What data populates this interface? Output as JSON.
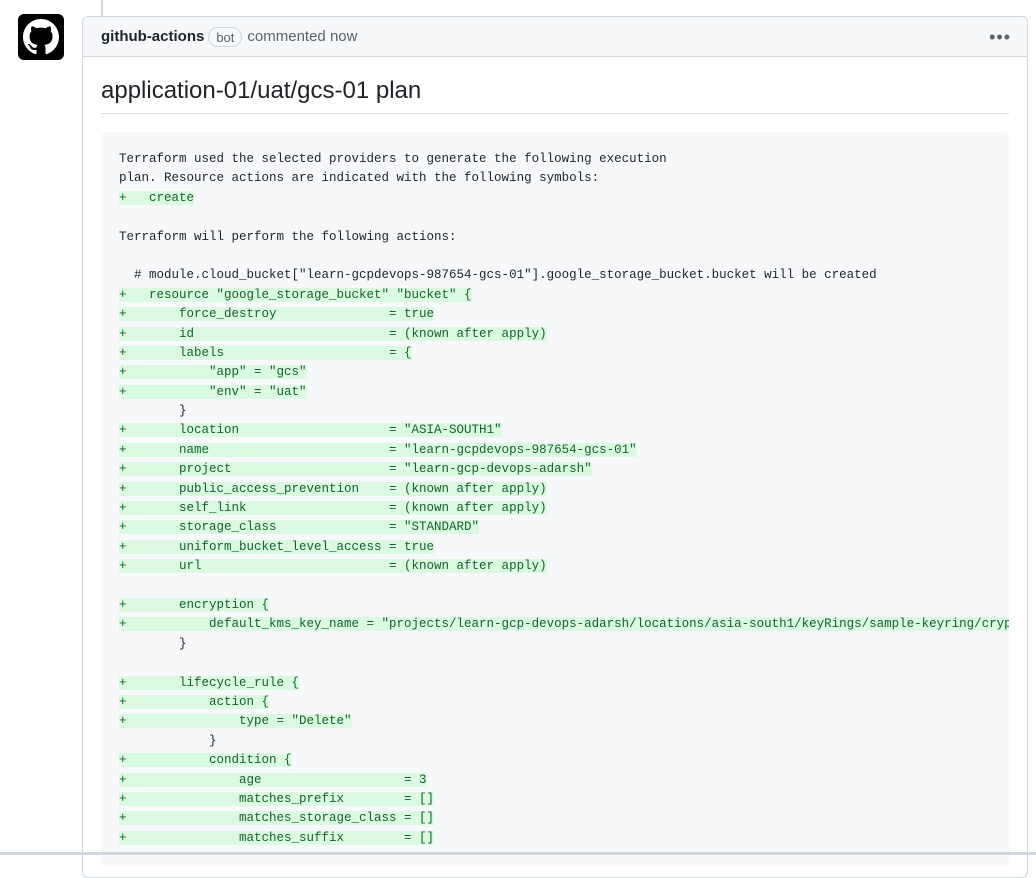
{
  "comment": {
    "author": "github-actions",
    "badge": "bot",
    "timestamp": "commented now",
    "menu_icon": "kebab-horizontal-icon",
    "avatar_icon": "github-octocat-icon"
  },
  "plan": {
    "title": "application-01/uat/gcs-01 plan",
    "lines": [
      {
        "text": "Terraform used the selected providers to generate the following execution",
        "kind": "plain"
      },
      {
        "text": "plan. Resource actions are indicated with the following symbols:",
        "kind": "plain"
      },
      {
        "text": "+   create",
        "kind": "add"
      },
      {
        "text": "",
        "kind": "plain"
      },
      {
        "text": "Terraform will perform the following actions:",
        "kind": "plain"
      },
      {
        "text": "",
        "kind": "plain"
      },
      {
        "text": "  # module.cloud_bucket[\"learn-gcpdevops-987654-gcs-01\"].google_storage_bucket.bucket will be created",
        "kind": "plain"
      },
      {
        "text": "+   resource \"google_storage_bucket\" \"bucket\" {",
        "kind": "add"
      },
      {
        "text": "+       force_destroy               = true",
        "kind": "add"
      },
      {
        "text": "+       id                          = (known after apply)",
        "kind": "add"
      },
      {
        "text": "+       labels                      = {",
        "kind": "add"
      },
      {
        "text": "+           \"app\" = \"gcs\"",
        "kind": "add"
      },
      {
        "text": "+           \"env\" = \"uat\"",
        "kind": "add"
      },
      {
        "text": "        }",
        "kind": "plain"
      },
      {
        "text": "+       location                    = \"ASIA-SOUTH1\"",
        "kind": "add"
      },
      {
        "text": "+       name                        = \"learn-gcpdevops-987654-gcs-01\"",
        "kind": "add"
      },
      {
        "text": "+       project                     = \"learn-gcp-devops-adarsh\"",
        "kind": "add"
      },
      {
        "text": "+       public_access_prevention    = (known after apply)",
        "kind": "add"
      },
      {
        "text": "+       self_link                   = (known after apply)",
        "kind": "add"
      },
      {
        "text": "+       storage_class               = \"STANDARD\"",
        "kind": "add"
      },
      {
        "text": "+       uniform_bucket_level_access = true",
        "kind": "add"
      },
      {
        "text": "+       url                         = (known after apply)",
        "kind": "add"
      },
      {
        "text": "",
        "kind": "plain"
      },
      {
        "text": "+       encryption {",
        "kind": "add"
      },
      {
        "text": "+           default_kms_key_name = \"projects/learn-gcp-devops-adarsh/locations/asia-south1/keyRings/sample-keyring/crypto",
        "kind": "add"
      },
      {
        "text": "        }",
        "kind": "plain"
      },
      {
        "text": "",
        "kind": "plain"
      },
      {
        "text": "+       lifecycle_rule {",
        "kind": "add"
      },
      {
        "text": "+           action {",
        "kind": "add"
      },
      {
        "text": "+               type = \"Delete\"",
        "kind": "add"
      },
      {
        "text": "            }",
        "kind": "plain"
      },
      {
        "text": "+           condition {",
        "kind": "add"
      },
      {
        "text": "+               age                   = 3",
        "kind": "add"
      },
      {
        "text": "+               matches_prefix        = []",
        "kind": "add"
      },
      {
        "text": "+               matches_storage_class = []",
        "kind": "add"
      },
      {
        "text": "+               matches_suffix        = []",
        "kind": "add"
      }
    ]
  }
}
